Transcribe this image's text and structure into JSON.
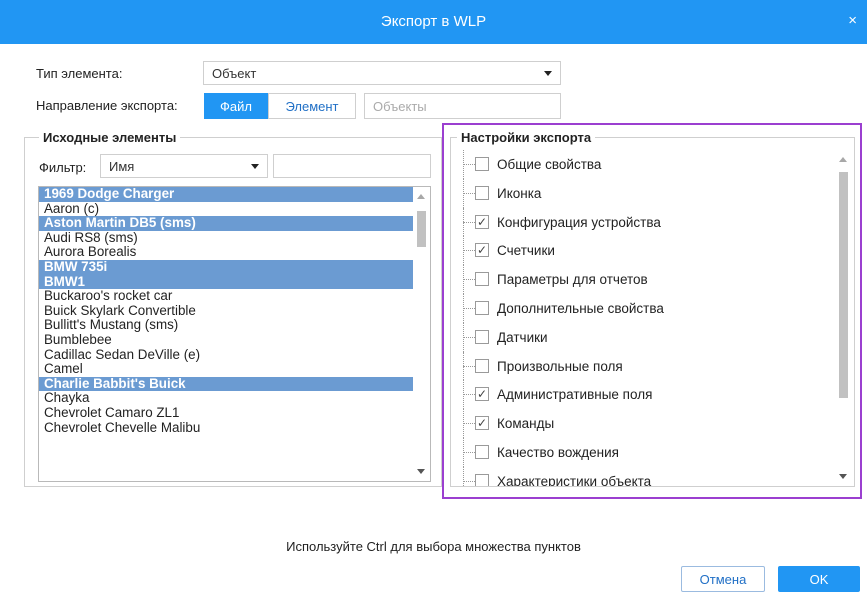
{
  "window": {
    "title": "Экспорт в WLP",
    "close_glyph": "×"
  },
  "colors": {
    "accent": "#2196f3",
    "selection": "#6b9bd2",
    "focus_outline": "#9b3fd0"
  },
  "element_type": {
    "label": "Тип элемента:",
    "value": "Объект"
  },
  "export_direction": {
    "label": "Направление экспорта:",
    "options": [
      "Файл",
      "Элемент"
    ],
    "selected": "Файл",
    "target_placeholder": "Объекты"
  },
  "source": {
    "legend": "Исходные элементы",
    "filter_label": "Фильтр:",
    "filter_by": "Имя",
    "filter_value": "",
    "items": [
      {
        "name": "1969 Dodge Charger",
        "selected": true
      },
      {
        "name": "Aaron (c)",
        "selected": false
      },
      {
        "name": "Aston Martin DB5 (sms)",
        "selected": true
      },
      {
        "name": "Audi RS8 (sms)",
        "selected": false
      },
      {
        "name": "Aurora Borealis",
        "selected": false
      },
      {
        "name": "BMW 735i",
        "selected": true
      },
      {
        "name": "BMW1",
        "selected": true
      },
      {
        "name": "Buckaroo's rocket car",
        "selected": false
      },
      {
        "name": "Buick Skylark Convertible",
        "selected": false
      },
      {
        "name": "Bullitt's Mustang (sms)",
        "selected": false
      },
      {
        "name": "Bumblebee",
        "selected": false
      },
      {
        "name": "Cadillac Sedan DeVille (e)",
        "selected": false
      },
      {
        "name": "Camel",
        "selected": false
      },
      {
        "name": "Charlie Babbit's Buick",
        "selected": true
      },
      {
        "name": "Chayka",
        "selected": false
      },
      {
        "name": "Chevrolet Camaro ZL1",
        "selected": false
      },
      {
        "name": "Chevrolet Chevelle Malibu",
        "selected": false
      }
    ]
  },
  "settings": {
    "legend": "Настройки экспорта",
    "checkmark_glyph": "✓",
    "items": [
      {
        "label": "Общие свойства",
        "checked": false
      },
      {
        "label": "Иконка",
        "checked": false
      },
      {
        "label": "Конфигурация устройства",
        "checked": true
      },
      {
        "label": "Счетчики",
        "checked": true
      },
      {
        "label": "Параметры для отчетов",
        "checked": false
      },
      {
        "label": "Дополнительные свойства",
        "checked": false
      },
      {
        "label": "Датчики",
        "checked": false
      },
      {
        "label": "Произвольные поля",
        "checked": false
      },
      {
        "label": "Административные поля",
        "checked": true
      },
      {
        "label": "Команды",
        "checked": true
      },
      {
        "label": "Качество вождения",
        "checked": false
      },
      {
        "label": "Характеристики объекта",
        "checked": false
      }
    ]
  },
  "footer": {
    "hint": "Используйте Ctrl для выбора множества пунктов",
    "cancel_label": "Отмена",
    "ok_label": "OK"
  }
}
